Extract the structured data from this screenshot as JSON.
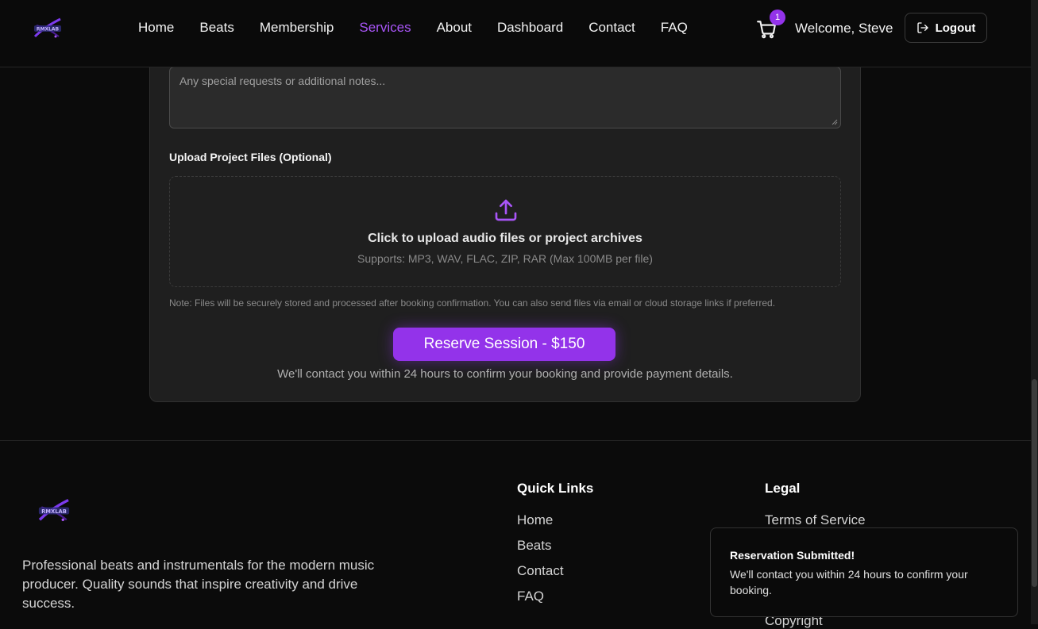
{
  "nav": {
    "links": [
      "Home",
      "Beats",
      "Membership",
      "Services",
      "About",
      "Dashboard",
      "Contact",
      "FAQ"
    ],
    "active": "Services"
  },
  "header": {
    "cart_count": "1",
    "welcome": "Welcome, Steve",
    "logout_label": "Logout"
  },
  "form": {
    "notes_placeholder": "Any special requests or additional notes...",
    "upload_label": "Upload Project Files (Optional)",
    "upload_title": "Click to upload audio files or project archives",
    "upload_sub": "Supports: MP3, WAV, FLAC, ZIP, RAR (Max 100MB per file)",
    "note": "Note: Files will be securely stored and processed after booking confirmation. You can also send files via email or cloud storage links if preferred.",
    "reserve_label": "Reserve Session - $150",
    "contact_note": "We'll contact you within 24 hours to confirm your booking and provide payment details."
  },
  "footer": {
    "description": "Professional beats and instrumentals for the modern music producer. Quality sounds that inspire creativity and drive success.",
    "quick_links_title": "Quick Links",
    "quick_links": [
      "Home",
      "Beats",
      "Contact",
      "FAQ"
    ],
    "legal_title": "Legal",
    "legal_links": [
      "Terms of Service",
      "Copyright"
    ]
  },
  "toast": {
    "title": "Reservation Submitted!",
    "message": "We'll contact you within 24 hours to confirm your booking."
  },
  "colors": {
    "accent": "#9333ea",
    "accent_text": "#a855f7",
    "background": "#0b0b0b",
    "card": "#1f1f1f"
  },
  "icons": [
    "logo-icon",
    "cart-icon",
    "logout-icon",
    "upload-icon"
  ]
}
